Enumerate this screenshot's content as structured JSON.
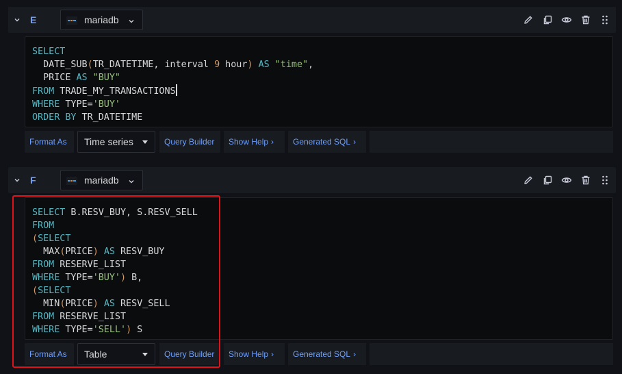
{
  "queries": [
    {
      "ref_id": "E",
      "datasource": "mariadb",
      "sql_lines": [
        "SELECT",
        "  DATE_SUB(TR_DATETIME, interval 9 hour) AS \"time\",",
        "  PRICE AS \"BUY\"",
        "FROM TRADE_MY_TRANSACTIONS",
        "WHERE TYPE='BUY'",
        "ORDER BY TR_DATETIME"
      ],
      "format_as_label": "Format As",
      "format_value": "Time series",
      "query_builder_label": "Query Builder",
      "show_help_label": "Show Help",
      "generated_sql_label": "Generated SQL"
    },
    {
      "ref_id": "F",
      "datasource": "mariadb",
      "sql_lines": [
        "SELECT B.RESV_BUY, S.RESV_SELL",
        "FROM",
        "(SELECT",
        "  MAX(PRICE) AS RESV_BUY",
        "FROM RESERVE_LIST",
        "WHERE TYPE='BUY') B,",
        "(SELECT",
        "  MIN(PRICE) AS RESV_SELL",
        "FROM RESERVE_LIST",
        "WHERE TYPE='SELL') S"
      ],
      "format_as_label": "Format As",
      "format_value": "Table",
      "query_builder_label": "Query Builder",
      "show_help_label": "Show Help",
      "generated_sql_label": "Generated SQL"
    }
  ],
  "icons": {
    "collapse": "chevron-down-icon",
    "datasource_chevron": "chevron-down-icon",
    "edit": "pencil-icon",
    "duplicate": "copy-icon",
    "toggle_visibility": "eye-icon",
    "delete": "trash-icon",
    "drag": "drag-handle-icon",
    "help_chevron": "chevron-right-icon",
    "sql_chevron": "chevron-right-icon"
  },
  "colors": {
    "background": "#111217",
    "panel": "#181b1f",
    "editor": "#0b0c0e",
    "accent": "#6e9fff",
    "keyword": "#56b6c2",
    "string": "#98c379",
    "number": "#d19a66",
    "highlight": "#e0131b"
  }
}
